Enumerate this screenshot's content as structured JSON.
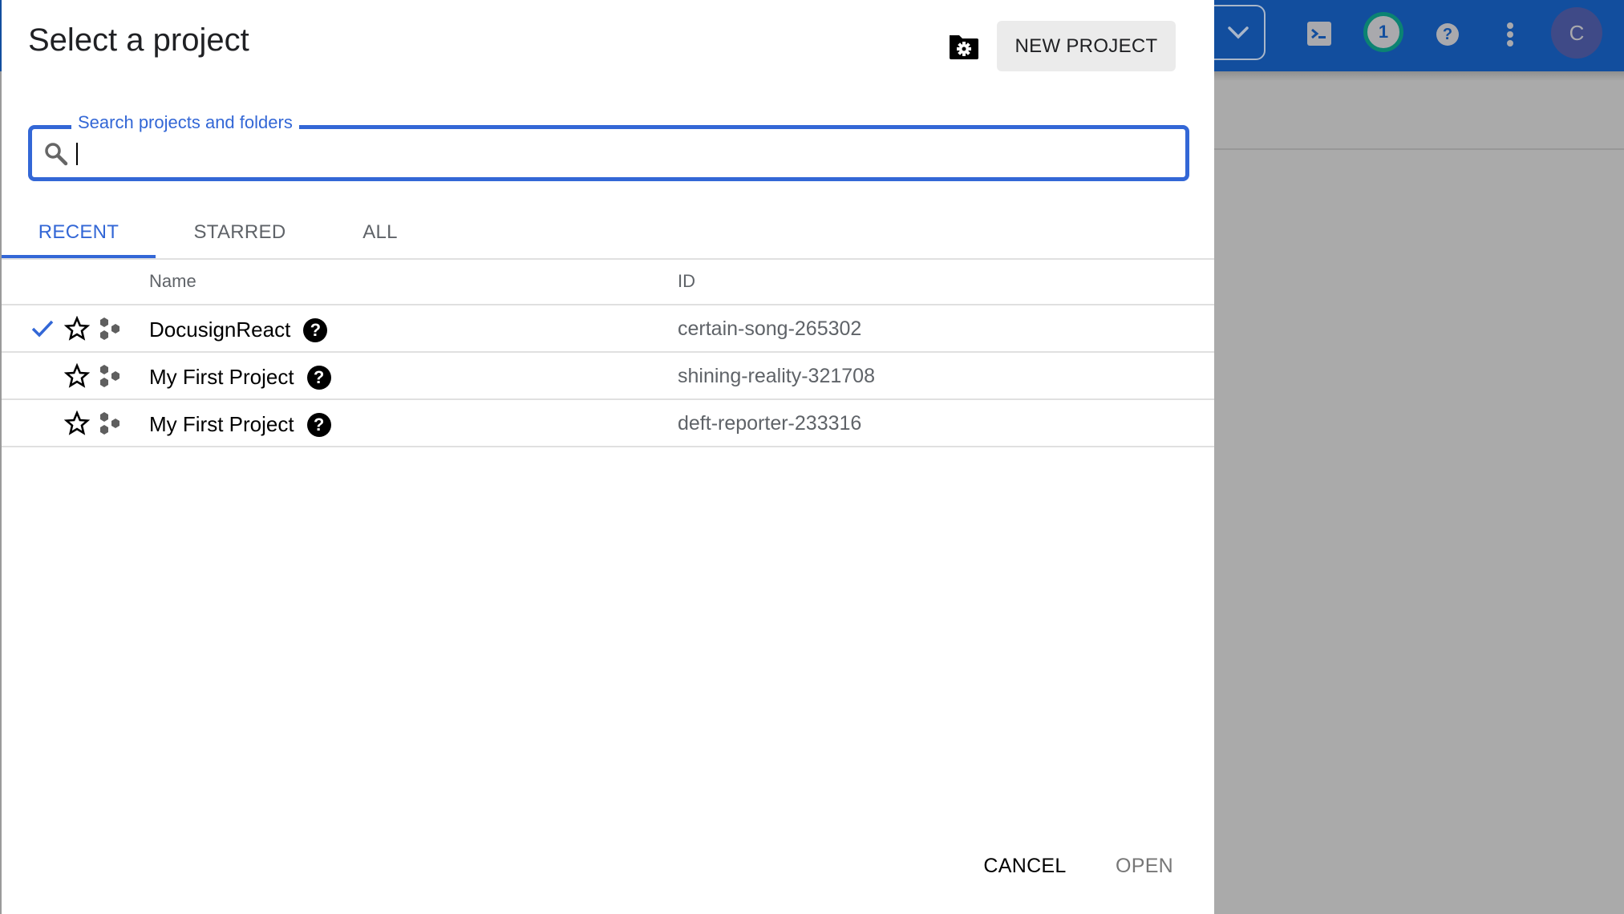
{
  "backdrop": {
    "header_color": "#124e9e",
    "notification_count": "1",
    "avatar_initial": "C",
    "icons": [
      "chevron-down-icon",
      "terminal-icon",
      "notification-badge",
      "help-icon",
      "more-vert-icon",
      "avatar"
    ]
  },
  "dialog": {
    "title": "Select a project",
    "manage_folder_icon": "folder-settings-icon",
    "new_project_label": "NEW PROJECT",
    "search": {
      "label": "Search projects and folders",
      "value": "",
      "placeholder": ""
    },
    "tabs": [
      {
        "label": "RECENT",
        "active": true
      },
      {
        "label": "STARRED",
        "active": false
      },
      {
        "label": "ALL",
        "active": false
      }
    ],
    "table": {
      "columns": [
        "Name",
        "ID"
      ],
      "rows": [
        {
          "selected": true,
          "starred": false,
          "name": "DocusignReact",
          "id": "certain-song-265302"
        },
        {
          "selected": false,
          "starred": false,
          "name": "My First Project",
          "id": "shining-reality-321708"
        },
        {
          "selected": false,
          "starred": false,
          "name": "My First Project",
          "id": "deft-reporter-233316"
        }
      ]
    },
    "footer": {
      "cancel_label": "CANCEL",
      "open_label": "OPEN"
    },
    "colors": {
      "accent": "#3367d6",
      "disabled": "#777777"
    }
  }
}
